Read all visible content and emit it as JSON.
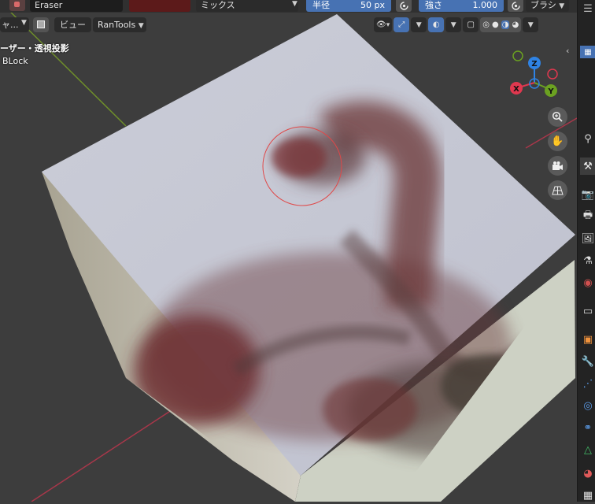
{
  "tool_settings": {
    "brush_name": "Eraser",
    "brush_color": "#5c1a1a",
    "blend_mode": "ミックス",
    "radius_label": "半径",
    "radius_value": "50 px",
    "strength_label": "強さ",
    "strength_value": "1.000",
    "brush_menu": "ブラシ"
  },
  "viewport_header": {
    "mode_label": "ャ...",
    "view_menu": "ビュー",
    "ran_tools": "RanTools"
  },
  "viewport": {
    "view_title": "ーザー・透視投影",
    "object_name": "BLock",
    "brush_cursor_color": "#e04848"
  },
  "gizmo": {
    "x_label": "X",
    "y_label": "Y",
    "z_label": "Z",
    "x_color": "#e0384f",
    "y_color": "#6ba121",
    "z_color": "#2f83e4"
  },
  "colors": {
    "accent": "#4772b3",
    "background": "#3d3d3d"
  }
}
